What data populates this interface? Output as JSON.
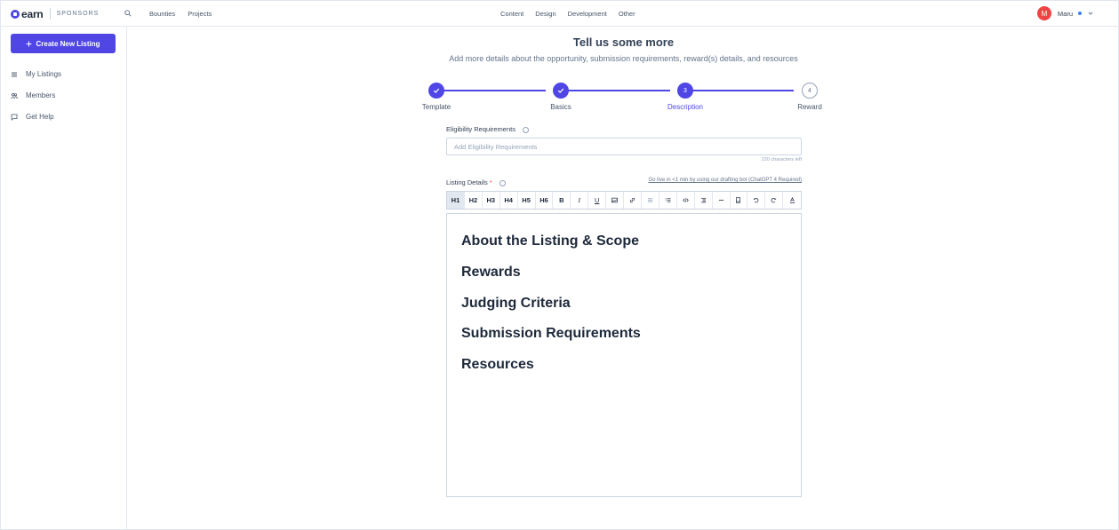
{
  "header": {
    "brand": "earn",
    "brand_sub": "SPONSORS",
    "nav_left": [
      "Bounties",
      "Projects"
    ],
    "nav_center": [
      "Content",
      "Design",
      "Development",
      "Other"
    ],
    "user": {
      "initial": "M",
      "name": "Maru"
    }
  },
  "sidebar": {
    "create_label": "Create New Listing",
    "items": [
      {
        "label": "My Listings",
        "icon": "list-icon"
      },
      {
        "label": "Members",
        "icon": "members-icon"
      },
      {
        "label": "Get Help",
        "icon": "chat-icon"
      }
    ]
  },
  "main": {
    "title": "Tell us some more",
    "subtitle": "Add more details about the opportunity, submission requirements, reward(s) details, and resources",
    "steps": [
      {
        "label": "Template",
        "state": "done"
      },
      {
        "label": "Basics",
        "state": "done"
      },
      {
        "label": "Description",
        "state": "current",
        "number": "3"
      },
      {
        "label": "Reward",
        "state": "todo",
        "number": "4"
      }
    ],
    "eligibility": {
      "label": "Eligibility Requirements",
      "placeholder": "Add Eligibility Requirements",
      "chars_left": "220 characters left"
    },
    "details": {
      "label": "Listing Details",
      "required_mark": "*",
      "drafting_link": "Go live in <1 min by using our drafting bot (ChatGPT 4 Required)"
    },
    "toolbar": {
      "headings": [
        "H1",
        "H2",
        "H3",
        "H4",
        "H5",
        "H6"
      ],
      "formatting": [
        "B",
        "I",
        "U"
      ]
    },
    "editor_headings": [
      "About the Listing & Scope",
      "Rewards",
      "Judging Criteria",
      "Submission Requirements",
      "Resources"
    ]
  },
  "colors": {
    "accent": "#4f46e5",
    "avatar": "#ef4444"
  }
}
